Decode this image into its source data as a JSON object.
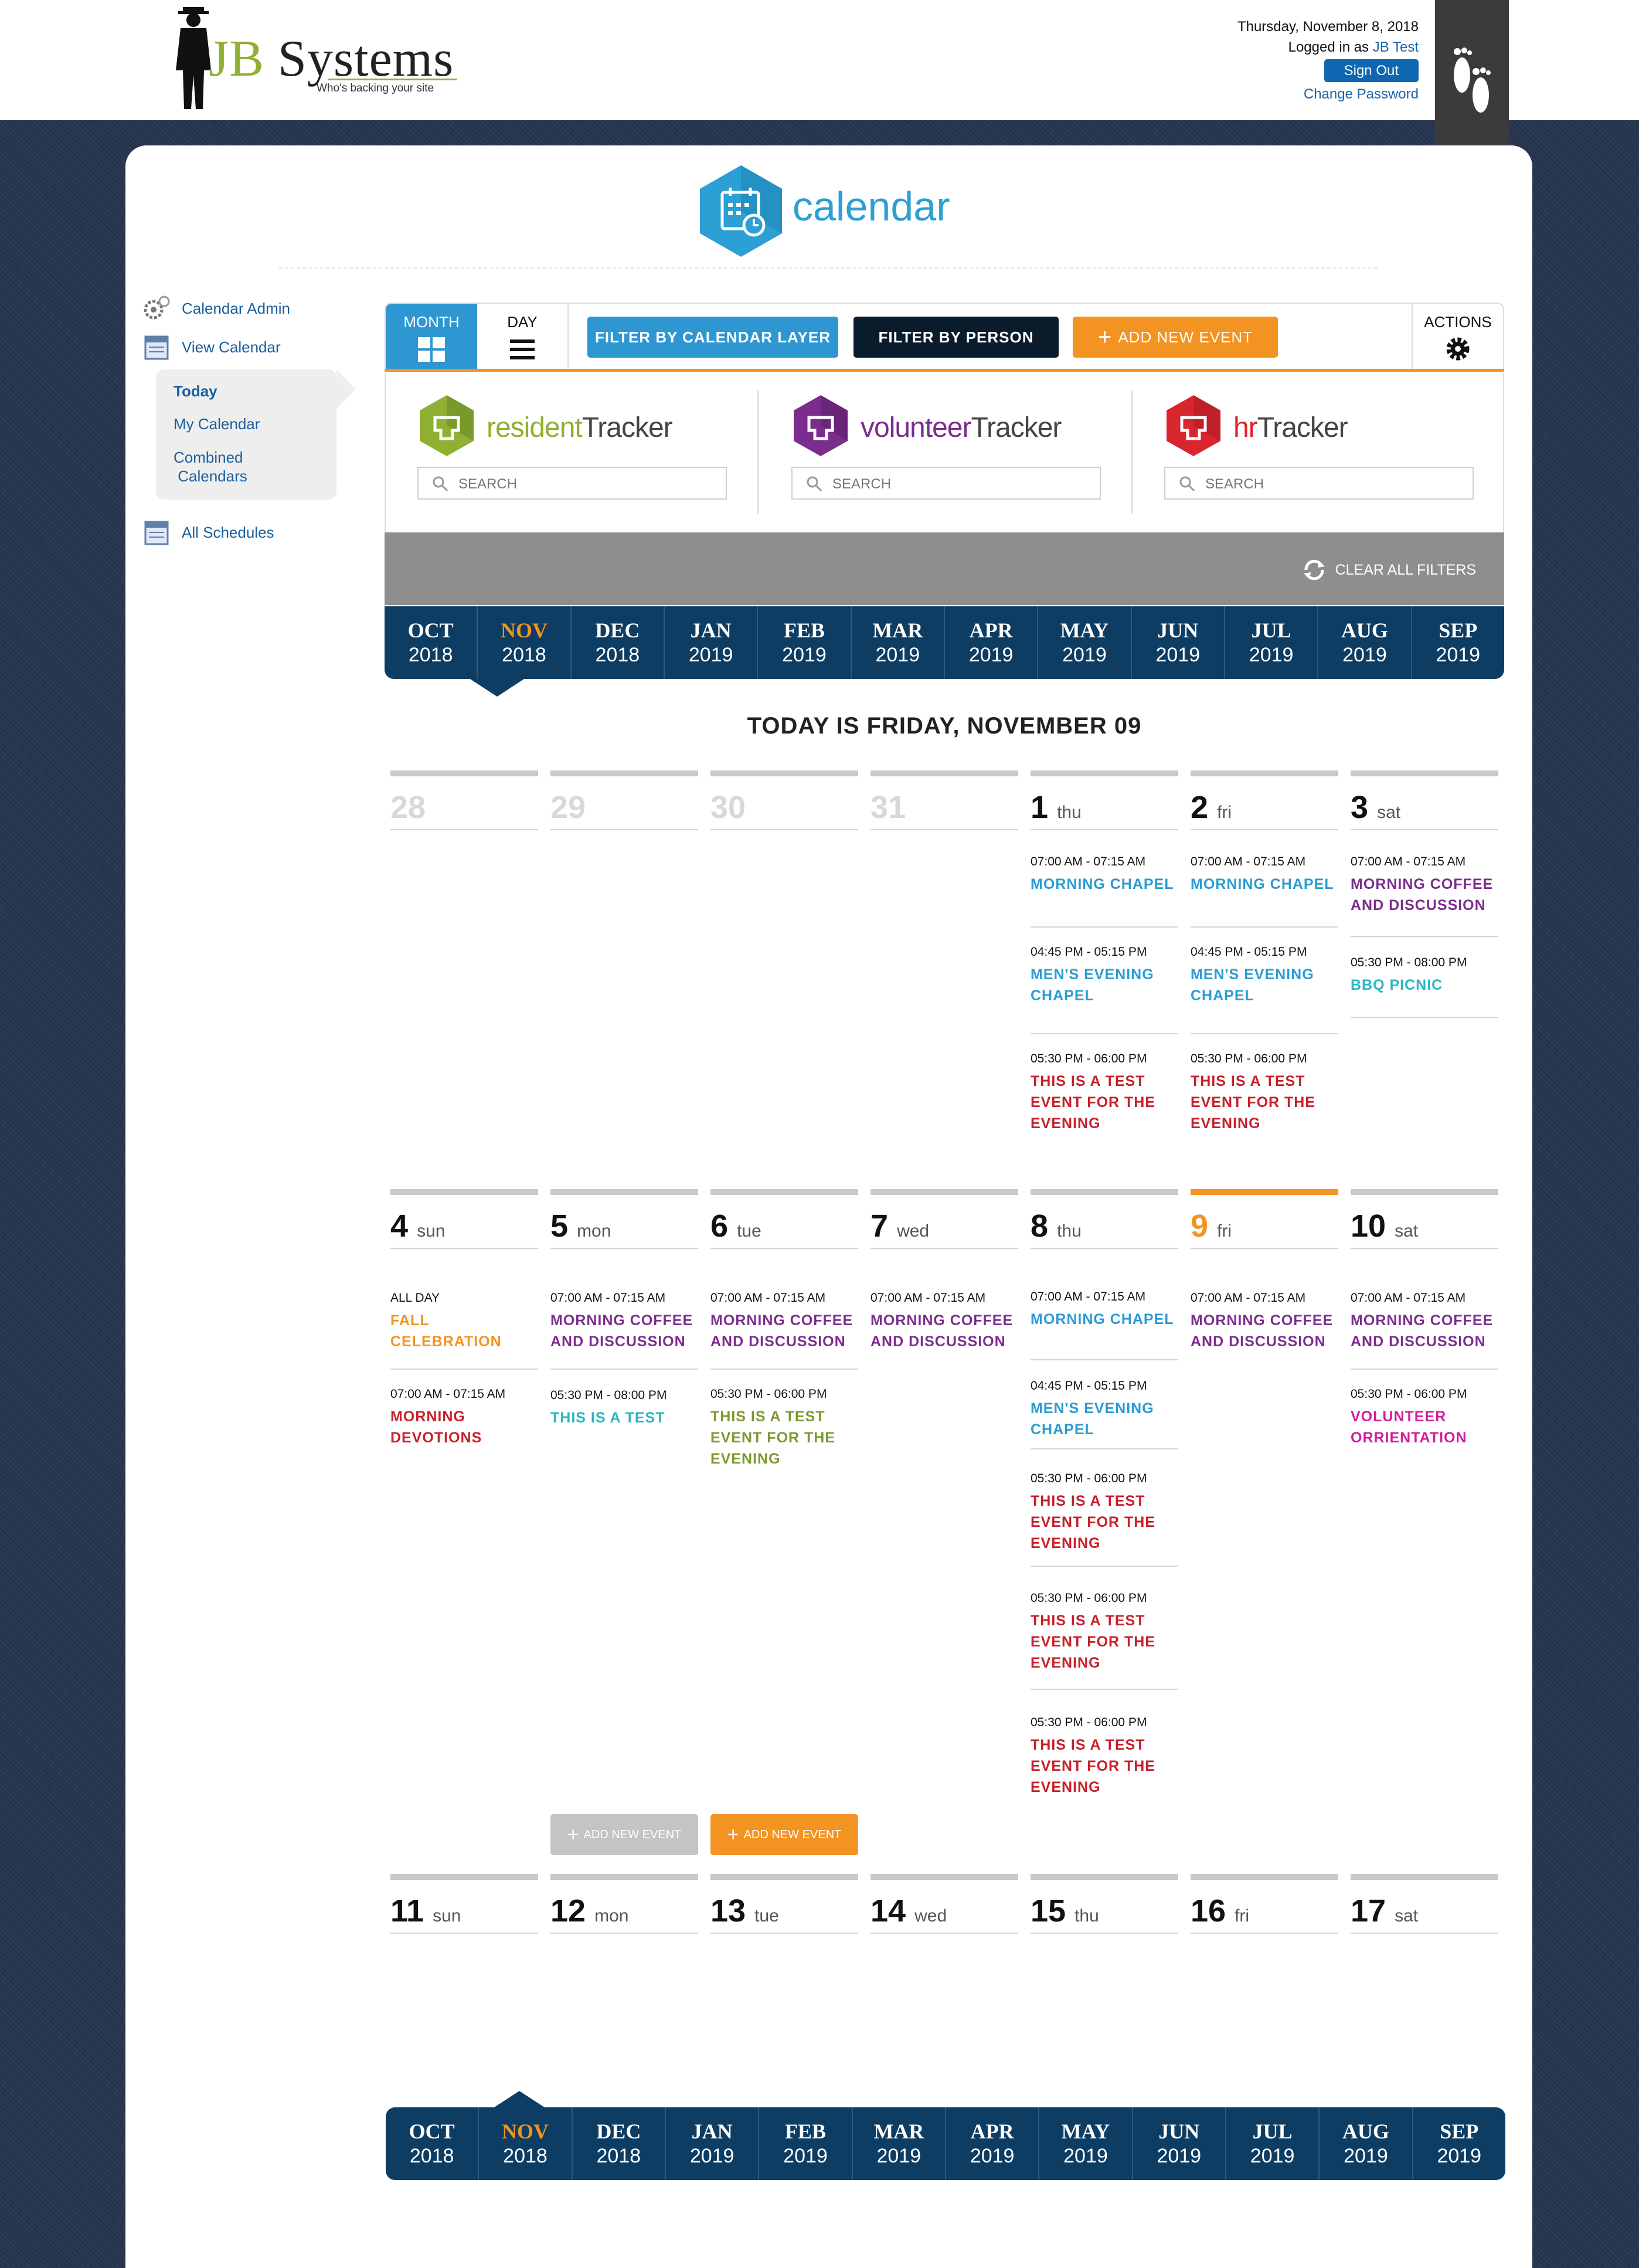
{
  "header": {
    "brand_jb": "JB",
    "brand_rest": " Systems",
    "tagline": "Who's backing your site",
    "date": "Thursday, November 8, 2018",
    "logged_prefix": "Logged in as",
    "user": "JB Test",
    "sign_out": "Sign Out",
    "change_password": "Change Password"
  },
  "app": {
    "title": "calendar"
  },
  "sidebar": {
    "admin": "Calendar Admin",
    "view": "View Calendar",
    "today": "Today",
    "my": "My Calendar",
    "combined1": "Combined",
    "combined2": "Calendars",
    "all": "All Schedules"
  },
  "toolbar": {
    "month": "MONTH",
    "day": "DAY",
    "filter_layer": "FILTER BY CALENDAR LAYER",
    "filter_person": "FILTER BY PERSON",
    "add_event": "ADD NEW EVENT",
    "actions": "ACTIONS"
  },
  "trackers": [
    {
      "a": "resident",
      "b": "Tracker",
      "search": "SEARCH",
      "color": "#8fb032"
    },
    {
      "a": "volunteer",
      "b": "Tracker",
      "search": "SEARCH",
      "color": "#7b2d8e"
    },
    {
      "a": "hr",
      "b": "Tracker",
      "search": "SEARCH",
      "color": "#d9252e"
    }
  ],
  "clear_filters": "CLEAR ALL FILTERS",
  "months": [
    {
      "m": "OCT",
      "y": "2018"
    },
    {
      "m": "NOV",
      "y": "2018"
    },
    {
      "m": "DEC",
      "y": "2018"
    },
    {
      "m": "JAN",
      "y": "2019"
    },
    {
      "m": "FEB",
      "y": "2019"
    },
    {
      "m": "MAR",
      "y": "2019"
    },
    {
      "m": "APR",
      "y": "2019"
    },
    {
      "m": "MAY",
      "y": "2019"
    },
    {
      "m": "JUN",
      "y": "2019"
    },
    {
      "m": "JUL",
      "y": "2019"
    },
    {
      "m": "AUG",
      "y": "2019"
    },
    {
      "m": "SEP",
      "y": "2019"
    }
  ],
  "active_month": "NOV",
  "today_text": "TODAY IS FRIDAY, NOVEMBER 09",
  "week1": [
    {
      "n": "28",
      "d": ""
    },
    {
      "n": "29",
      "d": ""
    },
    {
      "n": "30",
      "d": ""
    },
    {
      "n": "31",
      "d": ""
    },
    {
      "n": "1",
      "d": "thu"
    },
    {
      "n": "2",
      "d": "fri"
    },
    {
      "n": "3",
      "d": "sat"
    }
  ],
  "week2": [
    {
      "n": "4",
      "d": "sun"
    },
    {
      "n": "5",
      "d": "mon"
    },
    {
      "n": "6",
      "d": "tue"
    },
    {
      "n": "7",
      "d": "wed"
    },
    {
      "n": "8",
      "d": "thu"
    },
    {
      "n": "9",
      "d": "fri"
    },
    {
      "n": "10",
      "d": "sat"
    }
  ],
  "week3": [
    {
      "n": "11",
      "d": "sun"
    },
    {
      "n": "12",
      "d": "mon"
    },
    {
      "n": "13",
      "d": "tue"
    },
    {
      "n": "14",
      "d": "wed"
    },
    {
      "n": "15",
      "d": "thu"
    },
    {
      "n": "16",
      "d": "fri"
    },
    {
      "n": "17",
      "d": "sat"
    }
  ],
  "events": {
    "t715": "07:00 AM - 07:15 AM",
    "t445": "04:45 PM - 05:15 PM",
    "t530_6": "05:30 PM - 06:00 PM",
    "t530_8": "05:30 PM - 08:00 PM",
    "allday": "ALL DAY",
    "chapel": "MORNING CHAPEL",
    "mens1": "MEN'S EVENING",
    "mens2": "CHAPEL",
    "test1": "THIS IS A TEST",
    "test2": "EVENT FOR THE",
    "test3": "EVENING",
    "coffee1": "MORNING COFFEE",
    "coffee2": "AND DISCUSSION",
    "bbq": "BBQ PICNIC",
    "fall1": "FALL",
    "fall2": "CELEBRATION",
    "dev1": "MORNING",
    "dev2": "DEVOTIONS",
    "testshort": "THIS IS A TEST",
    "vol1": "VOLUNTEER",
    "vol2": "ORRIENTATION"
  },
  "add_new_event": "ADD NEW EVENT",
  "colors": {
    "blue": "#2a9bd3",
    "red": "#c8202b",
    "purple": "#7b2d8e",
    "teal": "#2bb6c2",
    "orange": "#f39322",
    "green": "#7c9a2e",
    "magenta": "#d11d9a",
    "navy": "#0e3d63"
  }
}
